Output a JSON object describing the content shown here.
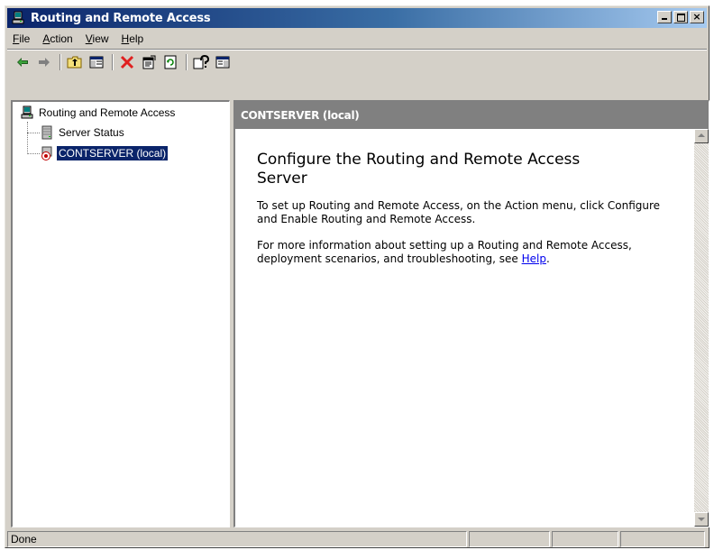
{
  "window": {
    "title": "Routing and Remote Access"
  },
  "title_buttons": {
    "minimize": "minimize-icon",
    "maximize": "maximize-icon",
    "close": "close-icon",
    "close_glyph": "×"
  },
  "menu": [
    {
      "label": "File"
    },
    {
      "label": "Action"
    },
    {
      "label": "View"
    },
    {
      "label": "Help"
    }
  ],
  "toolbar": {
    "buttons": [
      "back-arrow-icon",
      "forward-arrow-icon",
      "up-folder-icon",
      "show-hide-tree-icon",
      "delete-icon",
      "properties-icon",
      "refresh-icon",
      "help-icon",
      "console-pane-icon"
    ]
  },
  "tree": {
    "root": "Routing and Remote Access",
    "items": [
      {
        "label": "Server Status"
      },
      {
        "label": "CONTSERVER (local)"
      }
    ]
  },
  "right_pane": {
    "header": "CONTSERVER (local)",
    "title": "Configure the Routing and Remote Access Server",
    "para1": "To set up Routing and Remote Access, on the Action menu, click Configure and Enable Routing and Remote Access.",
    "para2_text": "For more information about setting up a Routing and Remote Access, deployment scenarios, and troubleshooting, see ",
    "para2_link": "Help",
    "para2_end": "."
  },
  "status": {
    "text": "Done"
  },
  "colors": {
    "titlebar_start": "#0a246a",
    "titlebar_end": "#a6caf0",
    "window_bg": "#d4d0c8",
    "selection": "#0a246a",
    "link": "#0000ee"
  }
}
